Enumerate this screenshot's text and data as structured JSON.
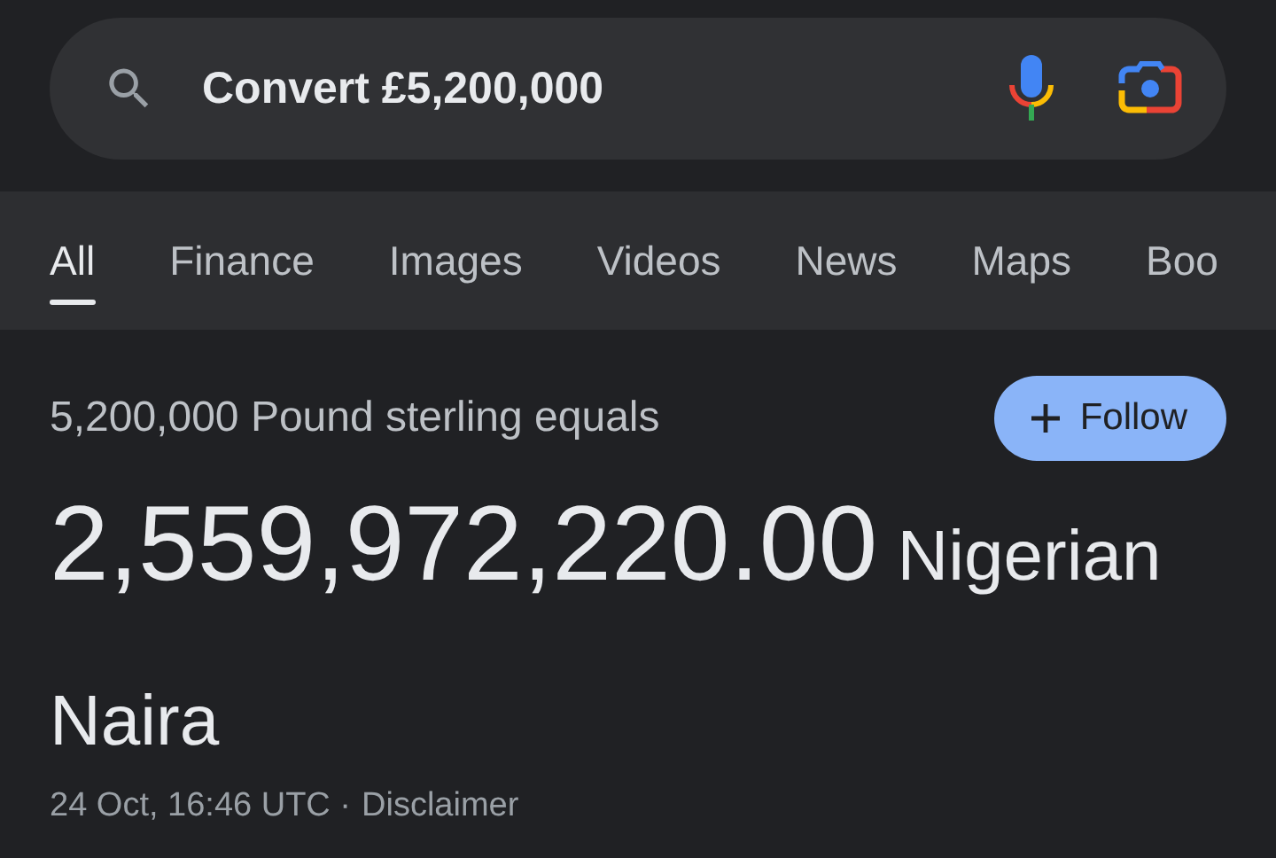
{
  "search": {
    "value": "Convert £5,200,000"
  },
  "tabs": [
    {
      "label": "All",
      "selected": true
    },
    {
      "label": "Finance",
      "selected": false
    },
    {
      "label": "Images",
      "selected": false
    },
    {
      "label": "Videos",
      "selected": false
    },
    {
      "label": "News",
      "selected": false
    },
    {
      "label": "Maps",
      "selected": false
    },
    {
      "label": "Boo",
      "selected": false
    }
  ],
  "result": {
    "source": "5,200,000 Pound sterling equals",
    "follow_button": "Follow",
    "amount": "2,559,972,220.00",
    "currency": "Nigerian Naira",
    "timestamp": "24 Oct, 16:46 UTC ·",
    "disclaimer": "Disclaimer"
  }
}
